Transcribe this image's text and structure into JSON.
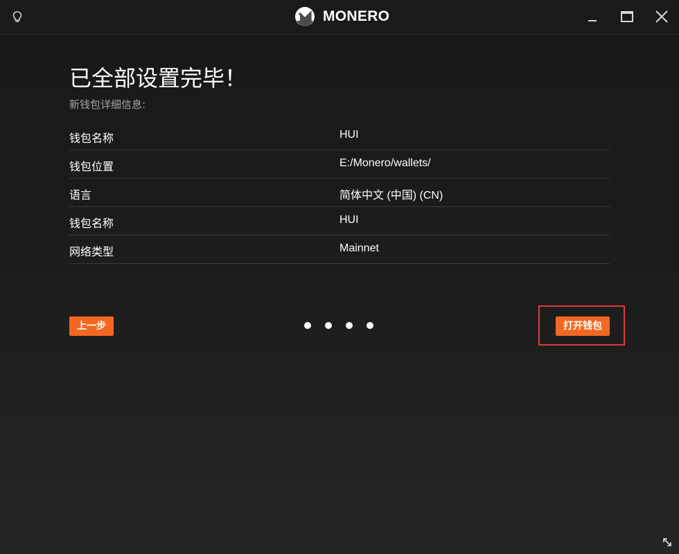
{
  "titlebar": {
    "app_name": "MONERO",
    "icons": [
      "bulb-icon",
      "monero-logo",
      "minimize-icon",
      "maximize-icon",
      "close-icon"
    ]
  },
  "page": {
    "title": "已全部设置完毕！",
    "subtitle": "新钱包详细信息:",
    "rows": [
      {
        "label": "钱包名称",
        "value": "HUI"
      },
      {
        "label": "钱包位置",
        "value": "E:/Monero/wallets/"
      },
      {
        "label": "语言",
        "value": "简体中文 (中国) (CN)"
      },
      {
        "label": "钱包名称",
        "value": "HUI"
      },
      {
        "label": "网络类型",
        "value": "Mainnet"
      }
    ]
  },
  "nav": {
    "back_label": "上一步",
    "open_label": "打开钱包",
    "step_dots": 4
  },
  "colors": {
    "accent": "#f26822",
    "highlight": "#e0393e",
    "background": "#1b1b1b"
  }
}
